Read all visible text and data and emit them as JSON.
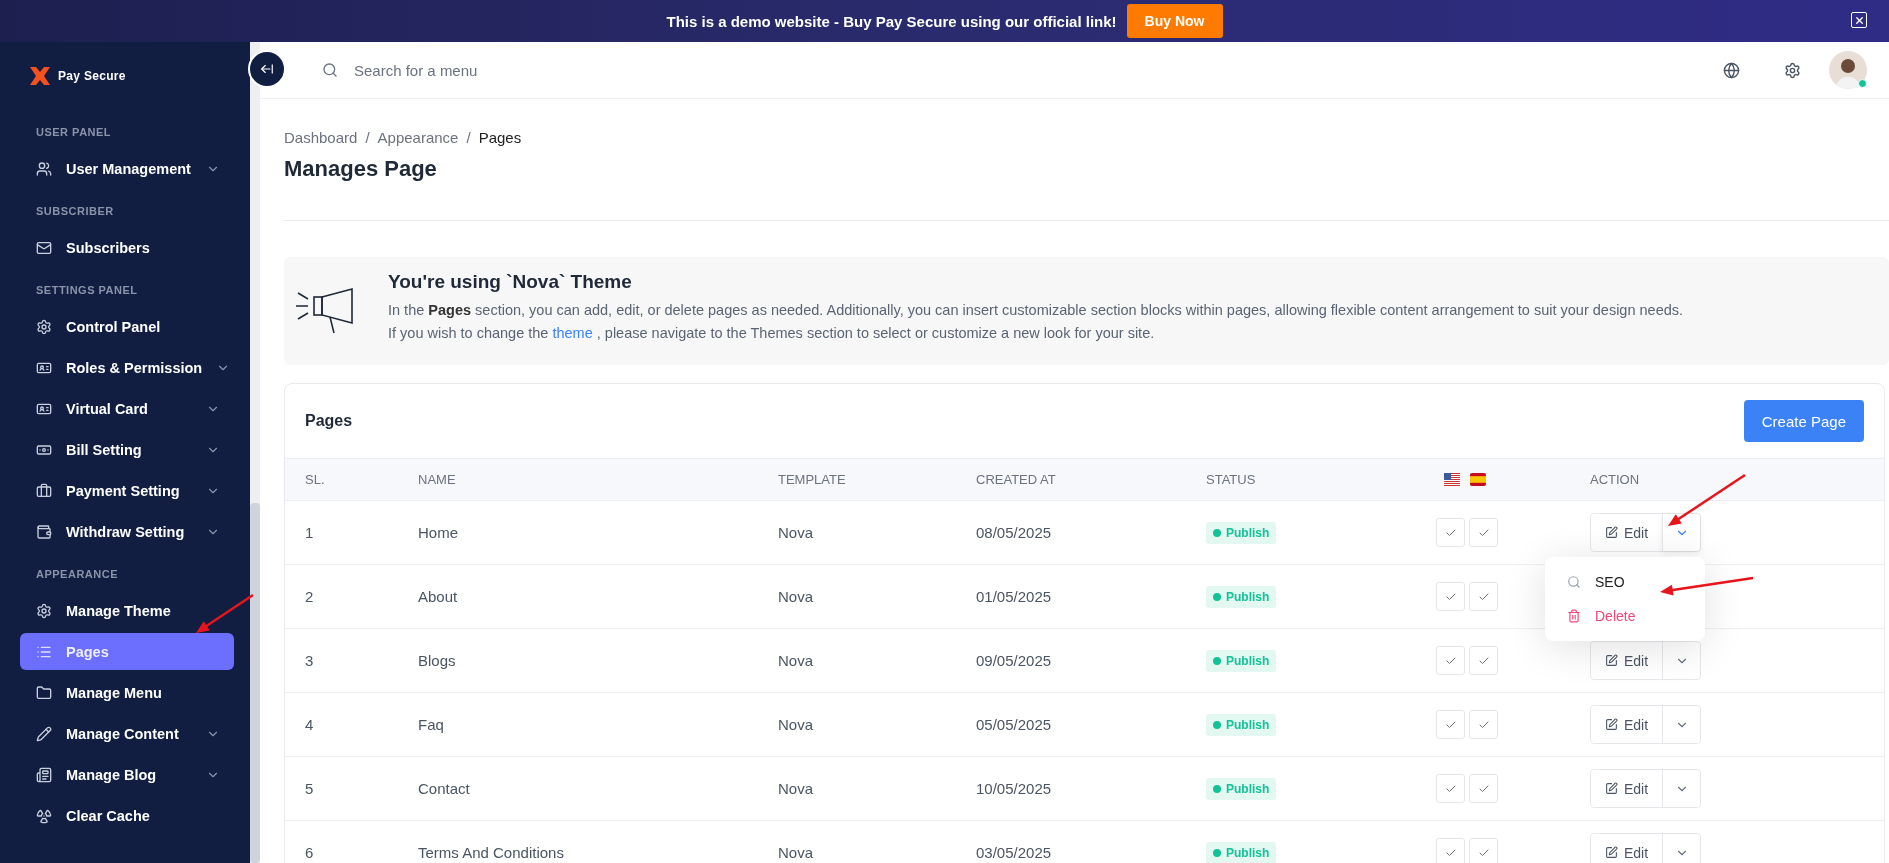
{
  "banner": {
    "text": "This is a demo website - Buy Pay Secure using our official link!",
    "button": "Buy Now"
  },
  "sidebar": {
    "logo": "Pay Secure",
    "sections": [
      {
        "title": "USER PANEL",
        "items": [
          {
            "label": "User Management",
            "expandable": true,
            "selected": false
          }
        ]
      },
      {
        "title": "SUBSCRIBER",
        "items": [
          {
            "label": "Subscribers",
            "expandable": false,
            "selected": false
          }
        ]
      },
      {
        "title": "SETTINGS PANEL",
        "items": [
          {
            "label": "Control Panel",
            "expandable": false,
            "selected": false
          },
          {
            "label": "Roles & Permission",
            "expandable": true,
            "selected": false
          },
          {
            "label": "Virtual Card",
            "expandable": true,
            "selected": false
          },
          {
            "label": "Bill Setting",
            "expandable": true,
            "selected": false
          },
          {
            "label": "Payment Setting",
            "expandable": true,
            "selected": false
          },
          {
            "label": "Withdraw Setting",
            "expandable": true,
            "selected": false
          }
        ]
      },
      {
        "title": "APPEARANCE",
        "items": [
          {
            "label": "Manage Theme",
            "expandable": false,
            "selected": false
          },
          {
            "label": "Pages",
            "expandable": false,
            "selected": true
          },
          {
            "label": "Manage Menu",
            "expandable": false,
            "selected": false
          },
          {
            "label": "Manage Content",
            "expandable": true,
            "selected": false
          },
          {
            "label": "Manage Blog",
            "expandable": true,
            "selected": false
          },
          {
            "label": "Clear Cache",
            "expandable": false,
            "selected": false
          }
        ]
      }
    ]
  },
  "topbar": {
    "search": {
      "placeholder": "Search for a menu"
    }
  },
  "breadcrumb": [
    "Dashboard",
    "Appearance",
    "Pages"
  ],
  "breadcrumb_separator": "/",
  "page_title": "Manages Page",
  "info": {
    "title": "You're using `Nova` Theme",
    "text": "In the **Pages** section, you can add, edit, or delete pages as needed. Additionally, you can insert customizable section blocks within pages, allowing flexible content arrangement to suit your design needs.",
    "text2_before": "If you wish to change the",
    "text2_link": "theme",
    "text2_after": ", please navigate to the Themes section to select or customize a new look for your site."
  },
  "pages_card": {
    "title": "Pages",
    "button": "Create Page",
    "columns": [
      "SL.",
      "NAME",
      "TEMPLATE",
      "CREATED AT",
      "STATUS",
      "ACTION"
    ],
    "rows": [
      {
        "sl": "1",
        "name": "Home",
        "template": "Nova",
        "created_at": "08/05/2025",
        "status": "Publish",
        "action": "Edit",
        "menu_open": true
      },
      {
        "sl": "2",
        "name": "About",
        "template": "Nova",
        "created_at": "01/05/2025",
        "status": "Publish"
      },
      {
        "sl": "3",
        "name": "Blogs",
        "template": "Nova",
        "created_at": "09/05/2025",
        "status": "Publish",
        "action": "Edit",
        "menu_open": false
      },
      {
        "sl": "4",
        "name": "Faq",
        "template": "Nova",
        "created_at": "05/05/2025",
        "status": "Publish",
        "action": "Edit",
        "menu_open": false
      },
      {
        "sl": "5",
        "name": "Contact",
        "template": "Nova",
        "created_at": "10/05/2025",
        "status": "Publish",
        "action": "Edit",
        "menu_open": false
      },
      {
        "sl": "6",
        "name": "Terms And Conditions",
        "template": "Nova",
        "created_at": "03/05/2025",
        "status": "Publish",
        "action": "Edit",
        "menu_open": false
      }
    ],
    "menu": [
      {
        "label": "SEO",
        "kind": "seo"
      },
      {
        "label": "Delete",
        "kind": "delete"
      }
    ]
  }
}
